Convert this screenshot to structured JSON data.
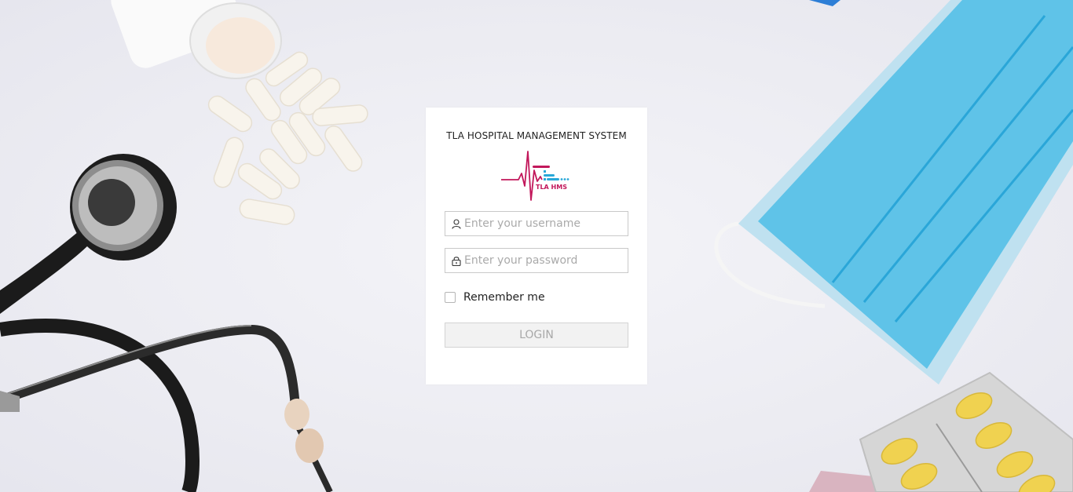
{
  "login_card": {
    "title": "TLA HOSPITAL MANAGEMENT SYSTEM",
    "logo_text": "TLA HMS",
    "username": {
      "value": "",
      "placeholder": "Enter your username",
      "icon": "user-icon"
    },
    "password": {
      "value": "",
      "placeholder": "Enter your password",
      "icon": "lock-icon"
    },
    "remember_label": "Remember me",
    "remember_checked": false,
    "login_label": "LOGIN"
  },
  "colors": {
    "logo_primary": "#c2185b",
    "logo_accent": "#29a8d8",
    "button_bg": "#f2f2f2",
    "button_text": "#a8a8a8"
  }
}
